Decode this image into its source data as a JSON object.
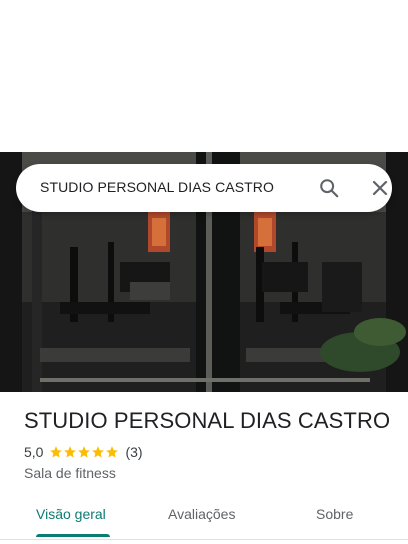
{
  "search": {
    "query": "STUDIO PERSONAL DIAS CASTRO",
    "search_icon": "search-icon",
    "close_icon": "close-icon"
  },
  "place": {
    "name": "STUDIO PERSONAL DIAS CASTRO",
    "rating": "5,0",
    "stars": 5,
    "review_count": "(3)",
    "category": "Sala de fitness",
    "photo": "gym-interior-photo"
  },
  "tabs": [
    {
      "label": "Visão geral",
      "active": true
    },
    {
      "label": "Avaliações",
      "active": false
    },
    {
      "label": "Sobre",
      "active": false
    }
  ],
  "colors": {
    "accent": "#0b7c72",
    "star": "#fbbc04",
    "text_primary": "#202124",
    "text_secondary": "#5f6368"
  }
}
